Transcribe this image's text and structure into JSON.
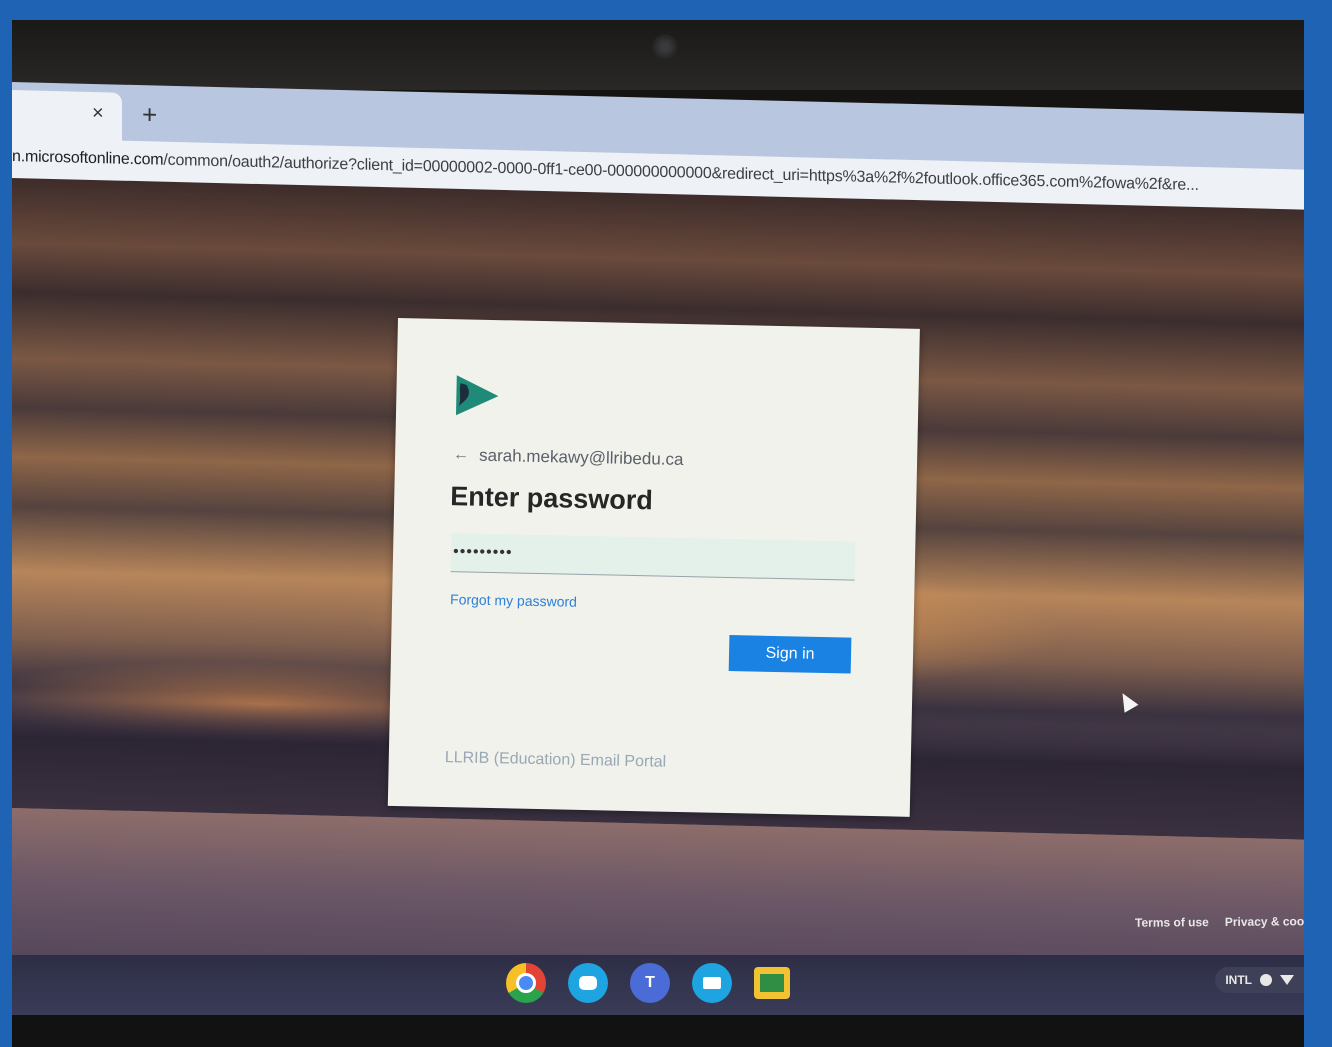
{
  "browser": {
    "tab_close": "×",
    "new_tab": "+",
    "url_host": "n.microsoftonline.com",
    "url_path": "/common/oauth2/authorize?client_id=00000002-0000-0ff1-ce00-000000000000&redirect_uri=https%3a%2f%2foutlook.office365.com%2fowa%2f&re..."
  },
  "signin_card": {
    "logo_icon": "org-logo-icon",
    "back_arrow": "←",
    "email": "sarah.mekawy@llribedu.ca",
    "title": "Enter password",
    "password_value": "•••••••••",
    "forgot_link": "Forgot my password",
    "signin_button": "Sign in",
    "footer": "LLRIB (Education) Email Portal"
  },
  "page_footer": {
    "terms": "Terms of use",
    "privacy": "Privacy & coo"
  },
  "shelf": {
    "apps": [
      "chrome-icon",
      "chat-icon",
      "teams-icon",
      "meet-icon",
      "classroom-icon"
    ],
    "teams_label": "T",
    "tray_label": "INTL"
  },
  "colors": {
    "accent": "#1a82e2",
    "link": "#2f7fd6"
  }
}
